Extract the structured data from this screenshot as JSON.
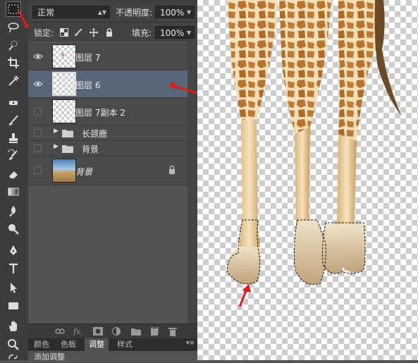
{
  "options": {
    "blend_mode": "正常",
    "opacity_label": "不透明度:",
    "opacity_value": "100%",
    "lock_label": "锁定:",
    "fill_label": "填充:",
    "fill_value": "100%"
  },
  "layers": [
    {
      "name": "图层 7",
      "visible": true
    },
    {
      "name": "图层 6",
      "visible": true,
      "selected": true
    },
    {
      "name": "图层 7副本 2",
      "visible": false
    },
    {
      "name": "长颈鹿",
      "visible": false,
      "group": true
    },
    {
      "name": "背景",
      "visible": false,
      "group": true
    },
    {
      "name": "背景",
      "visible": false,
      "locked": true
    }
  ],
  "bottom_tabs": [
    "颜色",
    "色板",
    "调整",
    "样式"
  ],
  "active_tab": "调整",
  "subtext": "添加调整",
  "colors": {
    "accent_arrow": "#e01b1b",
    "selected_layer": "#56677a"
  }
}
